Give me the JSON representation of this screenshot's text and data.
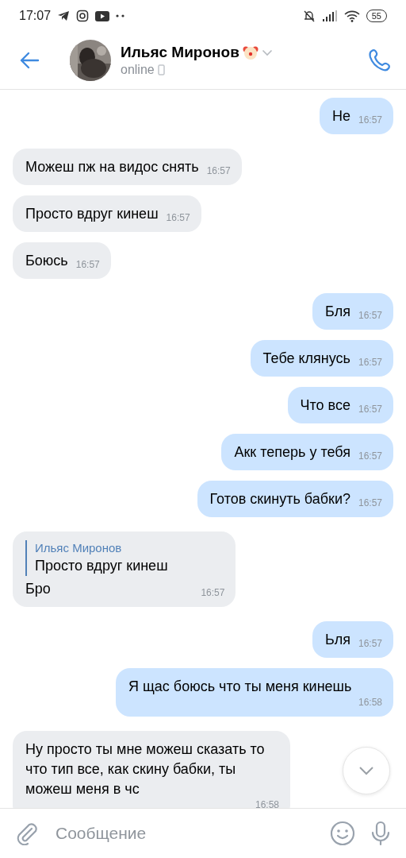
{
  "status_bar": {
    "time": "17:07",
    "battery": "55"
  },
  "header": {
    "name": "Ильяс Миронов",
    "status": "online"
  },
  "messages": [
    {
      "kind": "out",
      "text": "Не",
      "time": "16:57"
    },
    {
      "kind": "in",
      "text": "Можеш пж на видос снять",
      "time": "16:57"
    },
    {
      "kind": "in",
      "text": "Просто вдруг кинеш",
      "time": "16:57"
    },
    {
      "kind": "in",
      "text": "Боюсь",
      "time": "16:57"
    },
    {
      "kind": "out",
      "text": "Бля",
      "time": "16:57"
    },
    {
      "kind": "out",
      "text": "Тебе клянусь",
      "time": "16:57"
    },
    {
      "kind": "out",
      "text": "Что все",
      "time": "16:57"
    },
    {
      "kind": "out",
      "text": "Акк теперь у тебя",
      "time": "16:57"
    },
    {
      "kind": "out",
      "text": "Готов скинуть бабки?",
      "time": "16:57"
    },
    {
      "kind": "in",
      "reply": {
        "author": "Ильяс Миронов",
        "text": "Просто вдруг кинеш"
      },
      "text": "Бро",
      "time": "16:57"
    },
    {
      "kind": "out",
      "text": "Ьля",
      "time": "16:57"
    },
    {
      "kind": "out",
      "text": "Я щас боюсь что ты меня кинешь",
      "time": "16:58"
    },
    {
      "kind": "in",
      "text": "Ну просто ты мне можеш сказать то что тип все, как скину бабки, ты можеш меня в чс",
      "time": "16:58"
    }
  ],
  "composer": {
    "placeholder": "Сообщение"
  }
}
